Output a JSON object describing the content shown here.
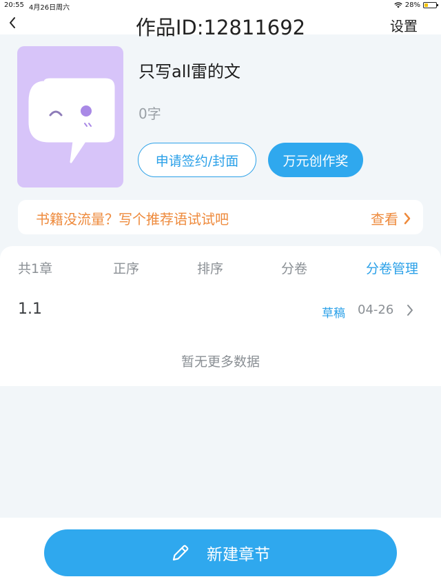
{
  "status_bar": {
    "time": "20:55",
    "date": "4月26日周六",
    "battery": "28%",
    "battery_level": 0.28
  },
  "nav": {
    "back_icon": "chevron-left-icon",
    "title": "作品ID:12811692",
    "settings_label": "设置"
  },
  "book": {
    "title": "只写all雷的文",
    "word_count": "0字",
    "apply_button": "申请签约/封面",
    "award_button": "万元创作奖"
  },
  "promo": {
    "text": "书籍没流量？写个推荐语试试吧",
    "link_label": "查看"
  },
  "chapter_tabs": {
    "total": "共1章",
    "order": "正序",
    "sort": "排序",
    "volume": "分卷",
    "manage": "分卷管理"
  },
  "chapters": [
    {
      "name": "1.1",
      "status": "草稿",
      "date": "04-26"
    }
  ],
  "empty_note": "暂无更多数据",
  "bottom": {
    "new_chapter_label": "新建章节",
    "icon": "pencil-icon"
  },
  "colors": {
    "accent_blue": "#2fa8ee",
    "promo_orange": "#ee8a3c",
    "cover_purple": "#d7c4f9",
    "background": "#f2f6f9"
  }
}
